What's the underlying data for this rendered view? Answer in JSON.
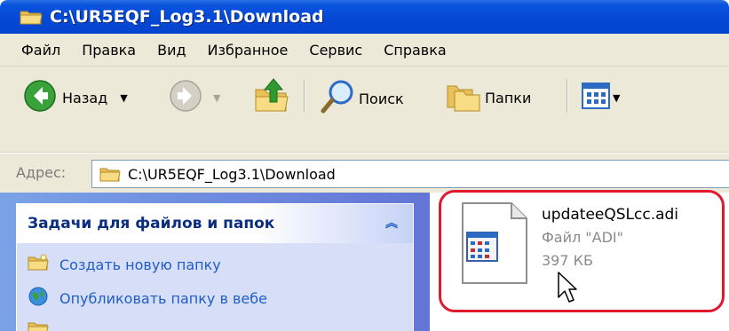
{
  "window": {
    "title": "C:\\UR5EQF_Log3.1\\Download"
  },
  "menu": {
    "items": [
      "Файл",
      "Правка",
      "Вид",
      "Избранное",
      "Сервис",
      "Справка"
    ]
  },
  "toolbar": {
    "back_label": "Назад",
    "search_label": "Поиск",
    "folders_label": "Папки"
  },
  "address": {
    "label": "Адрес:",
    "value": "C:\\UR5EQF_Log3.1\\Download"
  },
  "task_pane": {
    "header": "Задачи для файлов и папок",
    "items": [
      {
        "label": "Создать новую папку",
        "icon": "new-folder-icon"
      },
      {
        "label": "Опубликовать папку в вебе",
        "icon": "publish-web-icon"
      },
      {
        "label": "",
        "icon": "share-folder-icon"
      }
    ]
  },
  "file": {
    "name": "updateeQSLcc.adi",
    "type": "Файл \"ADI\"",
    "size": "397 КБ"
  },
  "colors": {
    "titlebar": "#0548d6",
    "highlight": "#e1182e",
    "task_link": "#215dc6"
  }
}
